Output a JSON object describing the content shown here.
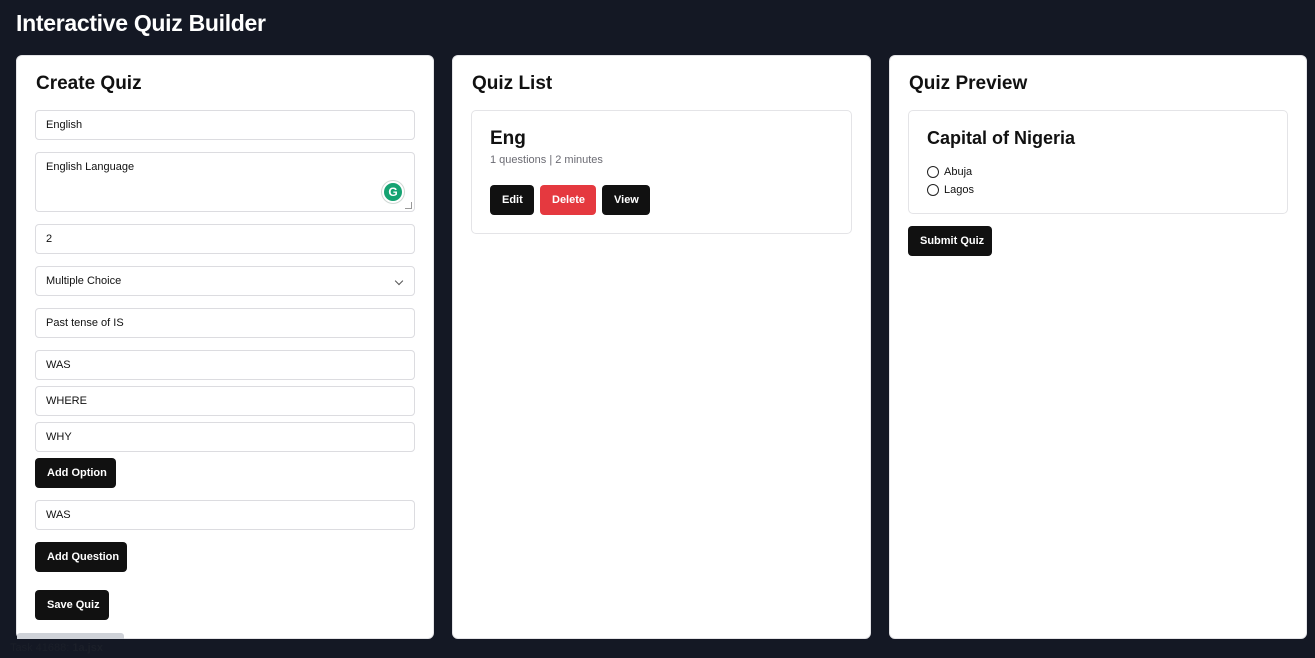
{
  "app": {
    "title": "Interactive Quiz Builder"
  },
  "create": {
    "title": "Create Quiz",
    "quiz_title_value": "English",
    "description_value": "English Language",
    "time_value": "2",
    "question_type_value": "Multiple Choice",
    "question_text_value": "Past tense of IS",
    "options": [
      "WAS",
      "WHERE",
      "WHY"
    ],
    "add_option_label": "Add Option",
    "correct_answer_value": "WAS",
    "add_question_label": "Add Question",
    "save_quiz_label": "Save Quiz",
    "grammarly_icon": "G"
  },
  "list": {
    "title": "Quiz List",
    "quizzes": [
      {
        "name": "Eng",
        "meta": "1 questions | 2 minutes",
        "edit_label": "Edit",
        "delete_label": "Delete",
        "view_label": "View"
      }
    ]
  },
  "preview": {
    "title": "Quiz Preview",
    "question": "Capital of Nigeria",
    "options": [
      "Abuja",
      "Lagos"
    ],
    "submit_label": "Submit Quiz"
  },
  "footer": {
    "task_prefix": "Task 41688:",
    "file": "1a.jsx"
  },
  "colors": {
    "background": "#141824",
    "accent_dark": "#111111",
    "danger": "#e5393f",
    "grammarly": "#15a372"
  }
}
